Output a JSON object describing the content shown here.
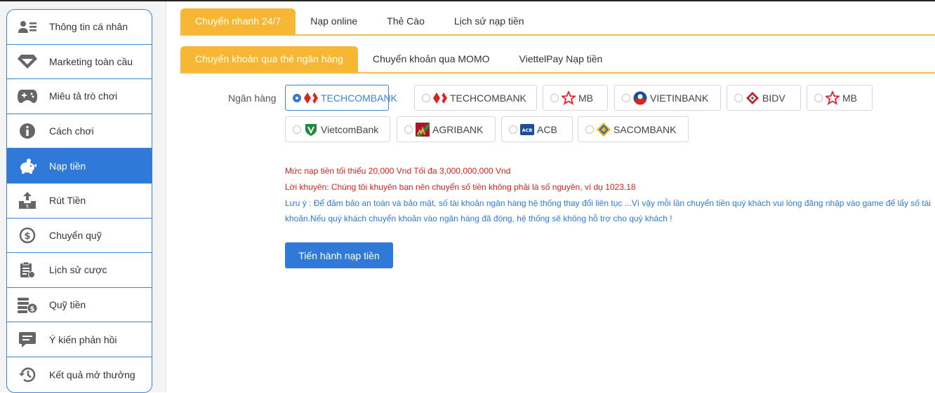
{
  "sidebar": {
    "items": [
      {
        "label": "Thông tin cá nhân",
        "icon": "user-card-icon"
      },
      {
        "label": "Marketing toàn cầu",
        "icon": "diamond-icon"
      },
      {
        "label": "Miêu tả trò chơi",
        "icon": "gamepad-icon"
      },
      {
        "label": "Cách chơi",
        "icon": "info-icon"
      },
      {
        "label": "Nạp tiền",
        "icon": "piggy-bank-icon",
        "active": true
      },
      {
        "label": "Rút Tiền",
        "icon": "withdraw-icon"
      },
      {
        "label": "Chuyển quỹ",
        "icon": "transfer-icon"
      },
      {
        "label": "Lịch sử cược",
        "icon": "clipboard-icon"
      },
      {
        "label": "Quỹ tiền",
        "icon": "coins-icon"
      },
      {
        "label": "Ý kiến phản hồi",
        "icon": "chat-icon"
      },
      {
        "label": "Kết quả mở thưởng",
        "icon": "history-icon"
      }
    ]
  },
  "tabs_top": [
    "Chuyển nhanh 24/7",
    "Nạp online",
    "Thẻ Cào",
    "Lịch sử nạp tiền"
  ],
  "tabs_sub": [
    "Chuyển khoản qua thẻ ngân hàng",
    "Chuyển khoản qua MOMO",
    "ViettelPay Nạp tiền"
  ],
  "bank_label": "Ngân hàng",
  "banks": [
    {
      "name": "TECHCOMBANK",
      "icon": "techcombank-logo-icon",
      "selected": true
    },
    {
      "name": "TECHCOMBANK",
      "icon": "techcombank-logo-icon"
    },
    {
      "name": "MB",
      "icon": "mb-star-icon"
    },
    {
      "name": "VIETINBANK",
      "icon": "vietinbank-logo-icon"
    },
    {
      "name": "BIDV",
      "icon": "bidv-logo-icon"
    },
    {
      "name": "MB",
      "icon": "mb-star-icon"
    },
    {
      "name": "VietcomBank",
      "icon": "vietcombank-logo-icon"
    },
    {
      "name": "AGRIBANK",
      "icon": "agribank-logo-icon"
    },
    {
      "name": "ACB",
      "icon": "acb-logo-icon"
    },
    {
      "name": "SACOMBANK",
      "icon": "sacombank-logo-icon"
    }
  ],
  "notes": {
    "min_max": "Mức nạp tiền tối thiểu 20,000 Vnd Tối đa 3,000,000,000 Vnd",
    "advice": "Lời khuyên: Chúng tôi khuyên bạn nên chuyển số tiền không phải là số nguyên, ví dụ 1023.18",
    "warning": "Lưu ý : Để đảm bảo an toàn và bảo mật, số tài khoản ngân hàng hệ thống thay đổi liên tục ...Vì vậy mỗi lần chuyển tiền quý khách vui lòng đăng nhập vào game để lấy số tài khoản.Nếu quý khách chuyển khoản vào ngân hàng đã đóng, hệ thống sẽ không hỗ trợ cho quý khách !"
  },
  "submit_label": "Tiến hành nạp tiền",
  "colors": {
    "accent": "#f7b733",
    "primary": "#2f7ad8",
    "warning_text": "#e0201c"
  }
}
